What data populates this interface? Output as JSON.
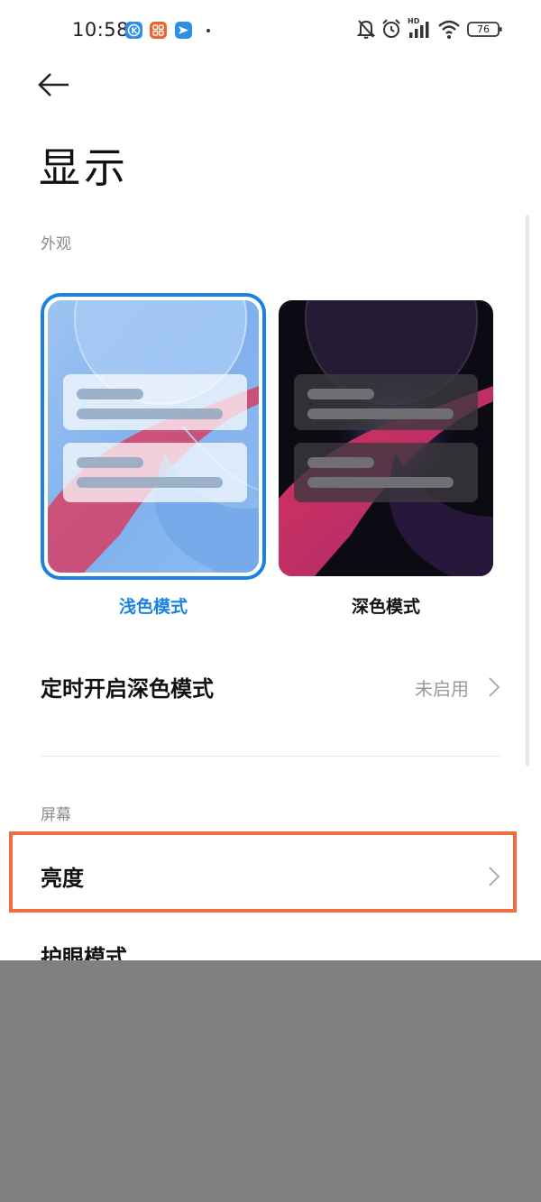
{
  "status_bar": {
    "time": "10:58",
    "app_icons": [
      "k-app-icon",
      "orange-app-icon",
      "send-app-icon"
    ],
    "battery": "76",
    "hd_label": "HD"
  },
  "header": {
    "title": "显示"
  },
  "appearance": {
    "section_label": "外观",
    "themes": [
      {
        "label": "浅色模式",
        "selected": true
      },
      {
        "label": "深色模式",
        "selected": false
      }
    ]
  },
  "dark_schedule": {
    "label": "定时开启深色模式",
    "value": "未启用"
  },
  "screen": {
    "section_label": "屏幕",
    "items": [
      {
        "label": "亮度"
      },
      {
        "label": "护眼模式"
      }
    ]
  },
  "colors": {
    "accent": "#1a82e2",
    "highlight_box": "#f26d3d",
    "mask": "#808080"
  }
}
